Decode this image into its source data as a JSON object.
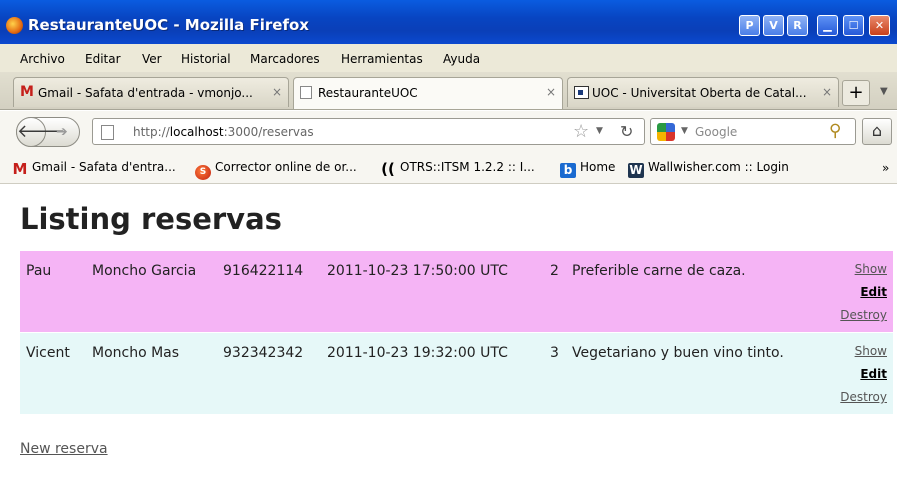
{
  "window": {
    "title": "RestauranteUOC - Mozilla Firefox"
  },
  "menu": [
    "Archivo",
    "Editar",
    "Ver",
    "Historial",
    "Marcadores",
    "Herramientas",
    "Ayuda"
  ],
  "tabs": [
    {
      "label": "Gmail - Safata d'entrada - vmonjo...",
      "close": "×",
      "icon": "gmail-icon"
    },
    {
      "label": "RestauranteUOC",
      "close": "×",
      "icon": "page-icon"
    },
    {
      "label": "UOC - Universitat Oberta de Catal...",
      "close": "×",
      "icon": "uoc-icon"
    }
  ],
  "nav": {
    "url_prefix": "http://",
    "url_host": "localhost",
    "url_rest": ":3000/reservas",
    "search_placeholder": "Google"
  },
  "bookmarks": [
    {
      "label": "Gmail - Safata d'entra...",
      "icon": "gmail-icon"
    },
    {
      "label": "Corrector online de or...",
      "icon": "corrector-icon"
    },
    {
      "label": "OTRS::ITSM 1.2.2 :: I...",
      "icon": "otrs-icon"
    },
    {
      "label": "Home",
      "icon": "home-b-icon"
    },
    {
      "label": "Wallwisher.com :: Login",
      "icon": "wallwisher-icon"
    }
  ],
  "page": {
    "title": "Listing reservas",
    "rows": [
      {
        "name": "Pau",
        "surname": "Moncho Garcia",
        "phone": "916422114",
        "date": "2011-10-23 17:50:00 UTC",
        "people": "2",
        "notes": "Preferible carne de caza."
      },
      {
        "name": "Vicent",
        "surname": "Moncho Mas",
        "phone": "932342342",
        "date": "2011-10-23 19:32:00 UTC",
        "people": "3",
        "notes": "Vegetariano y buen vino tinto."
      }
    ],
    "actions": {
      "show": "Show",
      "edit": "Edit",
      "destroy": "Destroy"
    },
    "new_link": "New reserva"
  }
}
